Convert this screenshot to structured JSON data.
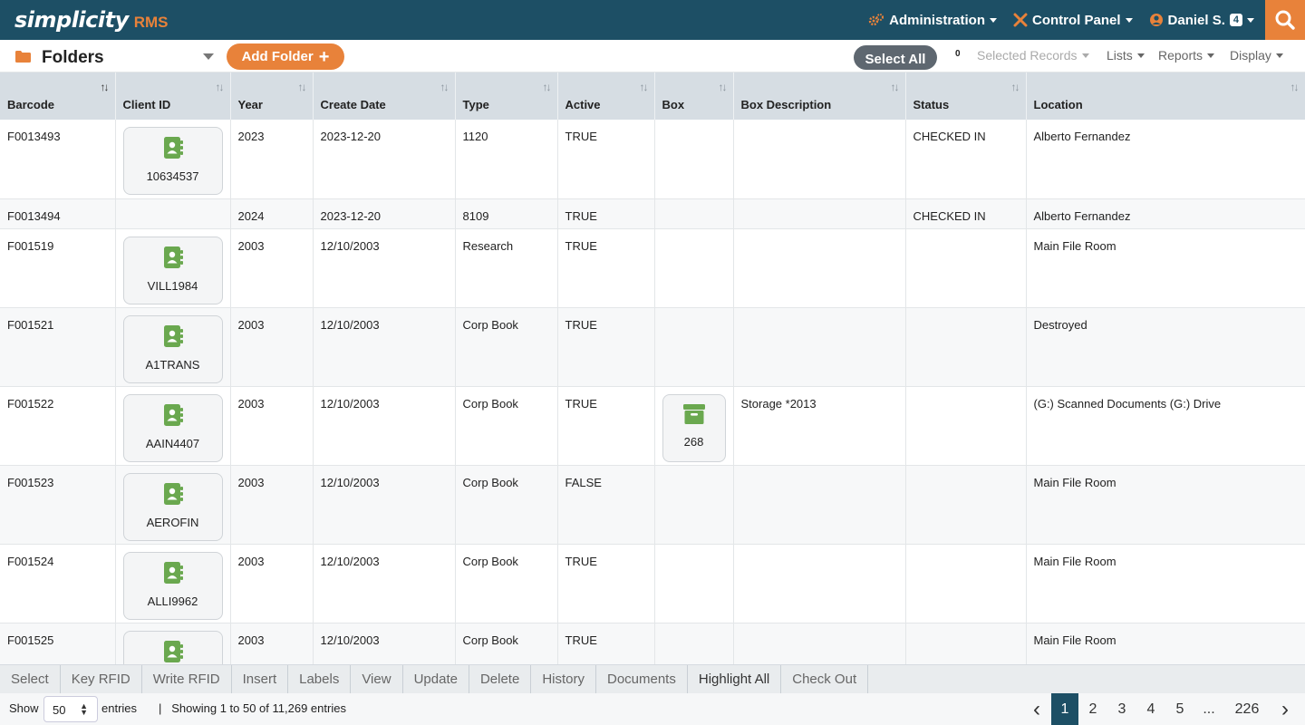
{
  "app": {
    "logo_main": "simplicity",
    "logo_sub": "RMS"
  },
  "topnav": {
    "administration": "Administration",
    "control_panel": "Control Panel",
    "user": "Daniel S.",
    "user_badge": "4"
  },
  "toolbar": {
    "title": "Folders",
    "add_folder": "Add Folder",
    "select_all": "Select All",
    "selected_count": "0",
    "selected_records": "Selected Records",
    "lists": "Lists",
    "reports": "Reports",
    "display": "Display"
  },
  "table": {
    "columns": [
      "Barcode",
      "Client ID",
      "Year",
      "Create Date",
      "Type",
      "Active",
      "Box",
      "Box Description",
      "Status",
      "Location"
    ],
    "rows": [
      {
        "barcode": "F0013493",
        "client_id": "10634537",
        "year": "2023",
        "create_date": "2023-12-20",
        "type": "1120",
        "active": "TRUE",
        "box": "",
        "box_description": "",
        "status": "CHECKED IN",
        "location": "Alberto Fernandez"
      },
      {
        "barcode": "F0013494",
        "client_id": "",
        "year": "2024",
        "create_date": "2023-12-20",
        "type": "8109",
        "active": "TRUE",
        "box": "",
        "box_description": "",
        "status": "CHECKED IN",
        "location": "Alberto Fernandez"
      },
      {
        "barcode": "F001519",
        "client_id": "VILL1984",
        "year": "2003",
        "create_date": "12/10/2003",
        "type": "Research",
        "active": "TRUE",
        "box": "",
        "box_description": "",
        "status": "",
        "location": "Main File Room"
      },
      {
        "barcode": "F001521",
        "client_id": "A1TRANS",
        "year": "2003",
        "create_date": "12/10/2003",
        "type": "Corp Book",
        "active": "TRUE",
        "box": "",
        "box_description": "",
        "status": "",
        "location": "Destroyed"
      },
      {
        "barcode": "F001522",
        "client_id": "AAIN4407",
        "year": "2003",
        "create_date": "12/10/2003",
        "type": "Corp Book",
        "active": "TRUE",
        "box": "268",
        "box_description": "Storage *2013",
        "status": "",
        "location": "(G:) Scanned Documents (G:) Drive"
      },
      {
        "barcode": "F001523",
        "client_id": "AEROFIN",
        "year": "2003",
        "create_date": "12/10/2003",
        "type": "Corp Book",
        "active": "FALSE",
        "box": "",
        "box_description": "",
        "status": "",
        "location": "Main File Room"
      },
      {
        "barcode": "F001524",
        "client_id": "ALLI9962",
        "year": "2003",
        "create_date": "12/10/2003",
        "type": "Corp Book",
        "active": "TRUE",
        "box": "",
        "box_description": "",
        "status": "",
        "location": "Main File Room"
      },
      {
        "barcode": "F001525",
        "client_id": "",
        "year": "2003",
        "create_date": "12/10/2003",
        "type": "Corp Book",
        "active": "TRUE",
        "box": "",
        "box_description": "",
        "status": "",
        "location": "Main File Room"
      }
    ]
  },
  "actions": [
    "Select",
    "Key RFID",
    "Write RFID",
    "Insert",
    "Labels",
    "View",
    "Update",
    "Delete",
    "History",
    "Documents",
    "Highlight All",
    "Check Out"
  ],
  "footer": {
    "show_label": "Show",
    "page_size": "50",
    "entries_label": "entries",
    "info": "|   Showing 1 to 50 of 11,269 entries",
    "pages": [
      "1",
      "2",
      "3",
      "4",
      "5",
      "...",
      "226"
    ],
    "current_page": "1"
  },
  "colors": {
    "header_bg": "#1d4f65",
    "accent": "#e8823a",
    "icon_green": "#6aa84f",
    "table_header_bg": "#d6dde3"
  },
  "icons": {
    "admin": "gears-icon",
    "control_panel": "tools-icon",
    "user": "user-circle-icon",
    "search": "search-icon",
    "folder": "folder-icon",
    "client": "contact-book-icon",
    "box": "archive-box-icon"
  }
}
